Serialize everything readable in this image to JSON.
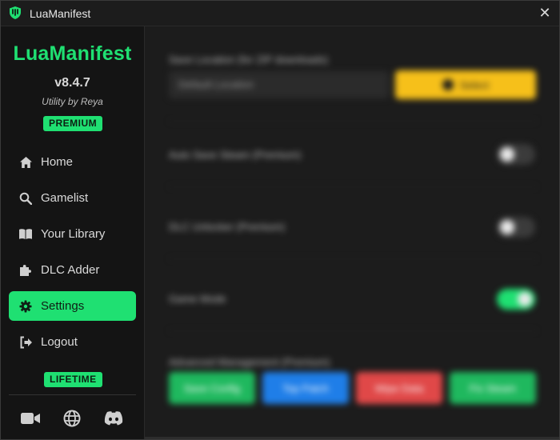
{
  "window": {
    "title": "LuaManifest",
    "close_symbol": "✕",
    "icon": "shield-logo-icon",
    "accent_color": "#1fe072"
  },
  "sidebar": {
    "brand": "LuaManifest",
    "version": "v8.4.7",
    "byline": "Utility by Reya",
    "badge_top": "PREMIUM",
    "badge_bottom": "LIFETIME",
    "items": [
      {
        "label": "Home",
        "icon": "home-icon",
        "active": false
      },
      {
        "label": "Gamelist",
        "icon": "search-icon",
        "active": false
      },
      {
        "label": "Your Library",
        "icon": "book-icon",
        "active": false
      },
      {
        "label": "DLC Adder",
        "icon": "puzzle-icon",
        "active": false
      },
      {
        "label": "Settings",
        "icon": "gear-icon",
        "active": true
      },
      {
        "label": "Logout",
        "icon": "logout-icon",
        "active": false
      }
    ],
    "social": [
      {
        "icon": "video-camera-icon"
      },
      {
        "icon": "globe-icon"
      },
      {
        "icon": "discord-icon"
      }
    ]
  },
  "main": {
    "blurred": true,
    "save_location_label": "Save Location (for ZIP downloads)",
    "save_location_value": "Default Location",
    "select_button": "Select",
    "auto_save_label": "Auto Save Steam (Premium)",
    "auto_save_on": false,
    "dlc_unlocker_label": "DLC Unlocker (Premium)",
    "dlc_unlocker_on": false,
    "game_mode_label": "Game Mode",
    "game_mode_on": true,
    "advanced_label": "Advanced Management (Premium)",
    "action_buttons": [
      {
        "label": "Save Config",
        "color": "#1fb85e"
      },
      {
        "label": "Top Patch",
        "color": "#1f7ee8"
      },
      {
        "label": "Wipe Data",
        "color": "#e04848"
      },
      {
        "label": "Fix Steam",
        "color": "#1fb85e"
      }
    ]
  }
}
